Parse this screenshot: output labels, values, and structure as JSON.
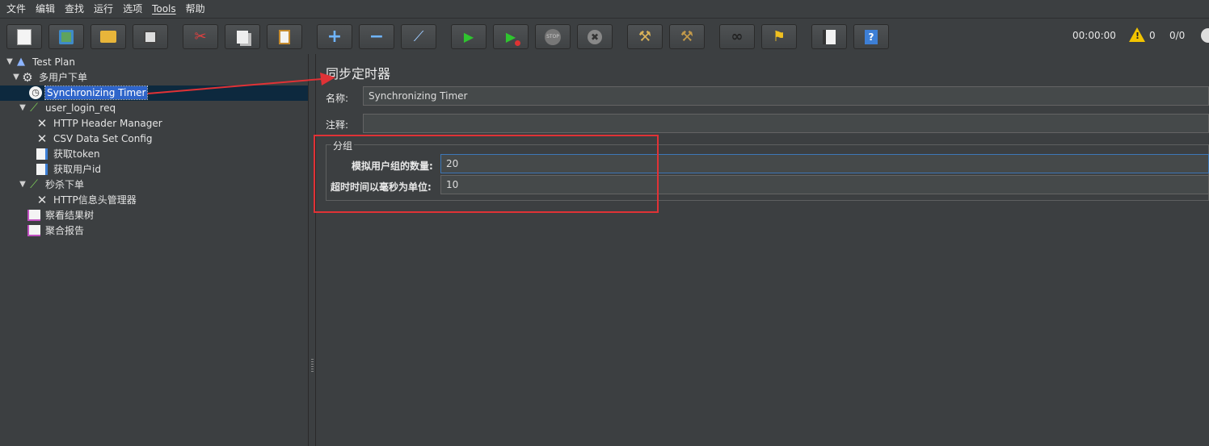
{
  "menu": [
    "文件",
    "编辑",
    "查找",
    "运行",
    "选项",
    "Tools",
    "帮助"
  ],
  "toolbar": {
    "buttons": [
      {
        "name": "new-icon",
        "glyph": "📄"
      },
      {
        "name": "templates-icon",
        "glyph": "🗂"
      },
      {
        "name": "open-icon",
        "glyph": "📂"
      },
      {
        "name": "save-icon",
        "glyph": "💾"
      },
      {
        "name": "cut-icon",
        "glyph": "✂"
      },
      {
        "name": "copy-icon",
        "glyph": "⧉"
      },
      {
        "name": "paste-icon",
        "glyph": "📋"
      },
      {
        "name": "expand-icon",
        "glyph": "+"
      },
      {
        "name": "collapse-icon",
        "glyph": "−"
      },
      {
        "name": "toggle-icon",
        "glyph": "⟋"
      },
      {
        "name": "start-icon",
        "glyph": "▶"
      },
      {
        "name": "start-no-pause-icon",
        "glyph": "▶"
      },
      {
        "name": "stop-icon",
        "glyph": "⬤"
      },
      {
        "name": "shutdown-icon",
        "glyph": "✖"
      },
      {
        "name": "clear-icon",
        "glyph": "🧹"
      },
      {
        "name": "clear-all-icon",
        "glyph": "🧹"
      },
      {
        "name": "search-icon",
        "glyph": "🔭"
      },
      {
        "name": "reset-search-icon",
        "glyph": "🧽"
      },
      {
        "name": "function-helper-icon",
        "glyph": "☰"
      },
      {
        "name": "help-icon",
        "glyph": "?"
      }
    ],
    "timer": "00:00:00",
    "warnings": "0",
    "threads": "0/0"
  },
  "tree": {
    "items": [
      {
        "label": "Test Plan",
        "icon": "flask-icon",
        "glyph": "🧪",
        "arrow": "▼"
      },
      {
        "label": "多用户下单",
        "icon": "gear-icon",
        "glyph": "⚙",
        "arrow": "▼"
      },
      {
        "label": "Synchronizing Timer",
        "icon": "timer-icon",
        "glyph": "⏱",
        "arrow": ""
      },
      {
        "label": "user_login_req",
        "icon": "pipette-icon",
        "glyph": "✒",
        "arrow": "▼"
      },
      {
        "label": "HTTP Header Manager",
        "icon": "wrench-icon",
        "glyph": "✕",
        "arrow": ""
      },
      {
        "label": "CSV Data Set Config",
        "icon": "wrench-icon",
        "glyph": "✕",
        "arrow": ""
      },
      {
        "label": "获取token",
        "icon": "extractor-icon",
        "glyph": "📄",
        "arrow": ""
      },
      {
        "label": "获取用户id",
        "icon": "extractor-icon",
        "glyph": "📄",
        "arrow": ""
      },
      {
        "label": "秒杀下单",
        "icon": "pipette-icon",
        "glyph": "✒",
        "arrow": "▼"
      },
      {
        "label": "HTTP信息头管理器",
        "icon": "wrench-icon",
        "glyph": "✕",
        "arrow": ""
      },
      {
        "label": "察看结果树",
        "icon": "listener-icon",
        "glyph": "📈",
        "arrow": ""
      },
      {
        "label": "聚合报告",
        "icon": "listener-icon",
        "glyph": "📈",
        "arrow": ""
      }
    ]
  },
  "panel": {
    "title": "同步定时器",
    "name_label": "名称:",
    "name_value": "Synchronizing Timer",
    "comment_label": "注释:",
    "comment_value": "",
    "group_legend": "分组",
    "users_label": "模拟用户组的数量:",
    "users_value": "20",
    "timeout_label": "超时时间以毫秒为单位:",
    "timeout_value": "10"
  },
  "colors": {
    "background": "#3c3f41",
    "selection": "#2f65ca",
    "annotation": "#e03236"
  }
}
